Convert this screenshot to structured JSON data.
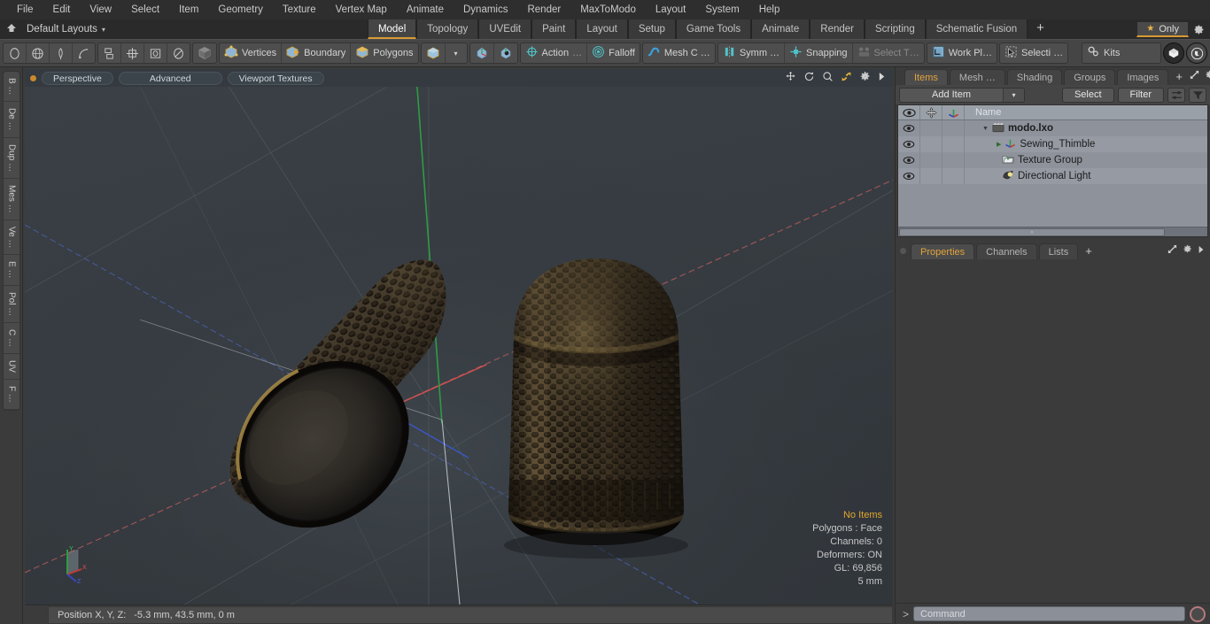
{
  "menu": {
    "items": [
      "File",
      "Edit",
      "View",
      "Select",
      "Item",
      "Geometry",
      "Texture",
      "Vertex Map",
      "Animate",
      "Dynamics",
      "Render",
      "MaxToModo",
      "Layout",
      "System",
      "Help"
    ]
  },
  "layout_row": {
    "home_icon": "home-icon",
    "layout_name": "Default Layouts",
    "caret": "▾",
    "tabs": [
      {
        "label": "Model",
        "active": true
      },
      {
        "label": "Topology",
        "active": false
      },
      {
        "label": "UVEdit",
        "active": false
      },
      {
        "label": "Paint",
        "active": false
      },
      {
        "label": "Layout",
        "active": false
      },
      {
        "label": "Setup",
        "active": false
      },
      {
        "label": "Game Tools",
        "active": false
      },
      {
        "label": "Animate",
        "active": false
      },
      {
        "label": "Render",
        "active": false
      },
      {
        "label": "Scripting",
        "active": false
      },
      {
        "label": "Schematic Fusion",
        "active": false
      }
    ],
    "add_tab": "+",
    "only_label": "Only",
    "only_star": "★",
    "gear": "gear-icon"
  },
  "toolbar": {
    "shape_tools": [
      "circle-icon",
      "globe-icon",
      "pen-icon",
      "curve-icon"
    ],
    "layout_tools": [
      "split-icon",
      "grid-icon",
      "square-icon",
      "ellipse-icon"
    ],
    "item_mode": "cube-icon",
    "selection_modes": [
      {
        "label": "Vertices",
        "icon": "vertices-icon"
      },
      {
        "label": "Boundary",
        "icon": "boundary-icon"
      },
      {
        "label": "Polygons",
        "icon": "polygons-icon"
      }
    ],
    "mesh_dropdown": {
      "icon": "cube-blue-icon",
      "caret": "▾"
    },
    "axis_icons": [
      "axis-a-icon",
      "axis-b-icon"
    ],
    "action": {
      "label": "Action",
      "ellipsis": "…",
      "icon": "action-center-icon"
    },
    "falloff": {
      "label": "Falloff",
      "icon": "falloff-icon"
    },
    "mesh_constraint": {
      "label": "Mesh C …",
      "icon": "mesh-constraint-icon"
    },
    "symmetry": {
      "label": "Symm …",
      "icon": "symmetry-icon"
    },
    "snapping": {
      "label": "Snapping",
      "icon": "snapping-icon"
    },
    "select_through": {
      "label": "Select T…",
      "icon": "select-through-icon",
      "disabled": true
    },
    "work_plane": {
      "label": "Work Pl…",
      "icon": "work-plane-icon"
    },
    "selection_set": {
      "label": "Selecti …",
      "icon": "selection-icon"
    },
    "kits": {
      "label": "Kits",
      "icon": "kits-icon"
    },
    "logo_modo": "modo-logo-icon",
    "logo_unreal": "unreal-logo-icon"
  },
  "left_strip": {
    "tabs": [
      "B …",
      "De …",
      "Dup …",
      "Mes …",
      "Ve …",
      "E …",
      "Pol …",
      "C …",
      "UV",
      "F …"
    ]
  },
  "viewport": {
    "dot": "viewport-indicator",
    "buttons": [
      "Perspective",
      "Advanced",
      "Viewport Textures"
    ],
    "icons": [
      "pan-icon",
      "rotate-icon",
      "zoom-icon",
      "fit-icon",
      "gear-icon",
      "arrow-right-icon"
    ],
    "stats": {
      "selection": "No Items",
      "polygons": "Polygons : Face",
      "channels": "Channels: 0",
      "deformers": "Deformers: ON",
      "gl": "GL: 69,856",
      "scale": "5 mm"
    },
    "gizmo": {
      "x": "X",
      "y": "Y",
      "z": "Z"
    },
    "background_color": "#363c41"
  },
  "scene": {
    "objects": [
      {
        "name": "thimble-tilted",
        "desc": "Bronze sewing thimble lying on its side, open end toward viewer"
      },
      {
        "name": "thimble-upright",
        "desc": "Bronze sewing thimble standing upright, dimpled surface"
      }
    ],
    "material_color": "#2b2620",
    "rim_highlight": "#b9952f"
  },
  "statusbar": {
    "position_label": "Position X, Y, Z:",
    "position_value": "-5.3 mm, 43.5 mm, 0 m"
  },
  "right_panel": {
    "top_tabs": [
      {
        "label": "Items",
        "active": true
      },
      {
        "label": "Mesh …",
        "active": false
      },
      {
        "label": "Shading",
        "active": false
      },
      {
        "label": "Groups",
        "active": false
      },
      {
        "label": "Images",
        "active": false
      }
    ],
    "top_tabs_add": "+",
    "top_tab_icons": [
      "expand-icon",
      "gear-icon",
      "arrow-right-icon"
    ],
    "item_bar": {
      "add_item": "Add Item",
      "add_item_caret": "▾",
      "select": "Select",
      "filter": "Filter",
      "list_icon": "list-options-icon",
      "funnel_icon": "funnel-icon"
    },
    "tree": {
      "columns": [
        "eye-icon",
        "move-icon",
        "axis-icon",
        "Name"
      ],
      "name_header": "Name",
      "rows": [
        {
          "label": "modo.lxo",
          "icon": "scene-icon",
          "depth": 0,
          "expander": "▼",
          "root": true
        },
        {
          "label": "Sewing_Thimble",
          "icon": "mesh-axis-icon",
          "depth": 1,
          "expander": "▶",
          "root": false
        },
        {
          "label": "Texture Group",
          "icon": "texture-group-icon",
          "depth": 1,
          "expander": "",
          "root": false
        },
        {
          "label": "Directional Light",
          "icon": "light-icon",
          "depth": 1,
          "expander": "",
          "root": false
        }
      ]
    },
    "bottom_tabs": [
      {
        "label": "Properties",
        "active": true
      },
      {
        "label": "Channels",
        "active": false
      },
      {
        "label": "Lists",
        "active": false
      }
    ],
    "bottom_tabs_add": "+",
    "bottom_tab_icons": [
      "expand-icon",
      "gear-icon",
      "arrow-right-icon"
    ]
  },
  "command_bar": {
    "prompt": ">",
    "placeholder": "Command",
    "record_icon": "record-icon"
  }
}
